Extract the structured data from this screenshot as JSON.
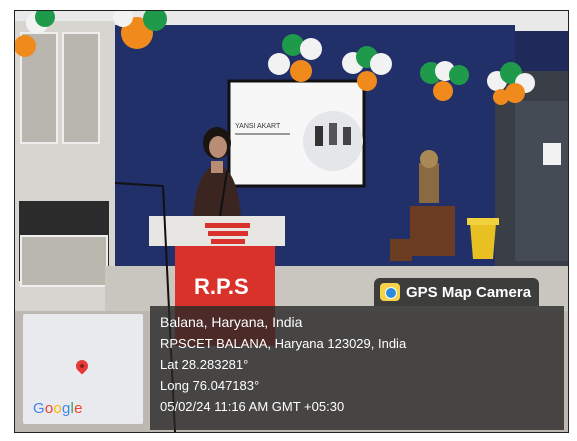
{
  "overlay": {
    "app_label": "GPS Map Camera",
    "location_line": "Balana, Haryana, India",
    "address_line": "RPSCET BALANA, Haryana 123029, India",
    "lat_line": "Lat 28.283281°",
    "long_line": "Long 76.047183°",
    "datetime_line": "05/02/24 11:16 AM GMT +05:30"
  },
  "map": {
    "brand": "Google"
  },
  "scene": {
    "podium_text": "R.P.S",
    "slide_text": "YANSI AKART"
  },
  "colors": {
    "wall": "#22306a",
    "balloon_green": "#1f9a4a",
    "balloon_orange": "#f08a1d",
    "balloon_white": "#f2f2f2",
    "podium_red": "#d8322b"
  }
}
